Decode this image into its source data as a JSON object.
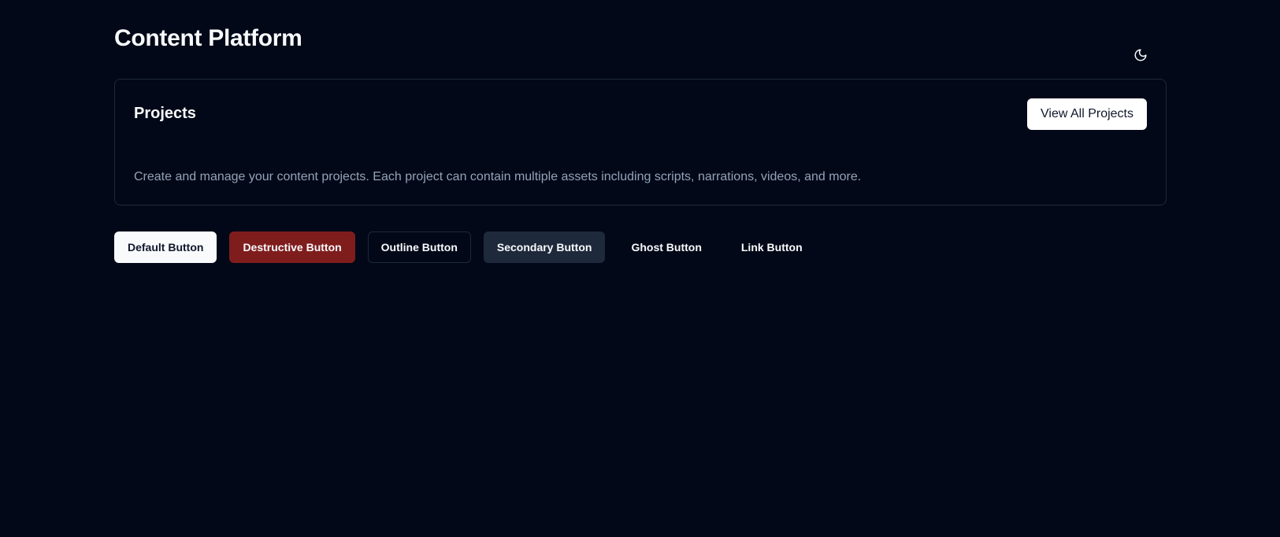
{
  "header": {
    "title": "Content Platform",
    "theme_toggle_icon": "moon-icon"
  },
  "projects_card": {
    "title": "Projects",
    "view_all_label": "View All Projects",
    "description": "Create and manage your content projects. Each project can contain multiple assets including scripts, narrations, videos, and more."
  },
  "buttons": {
    "default": "Default Button",
    "destructive": "Destructive Button",
    "outline": "Outline Button",
    "secondary": "Secondary Button",
    "ghost": "Ghost Button",
    "link": "Link Button"
  },
  "colors": {
    "background": "#020817",
    "destructive": "#7f1d1d",
    "secondary": "#1e293b",
    "muted_text": "#94a3b8"
  }
}
